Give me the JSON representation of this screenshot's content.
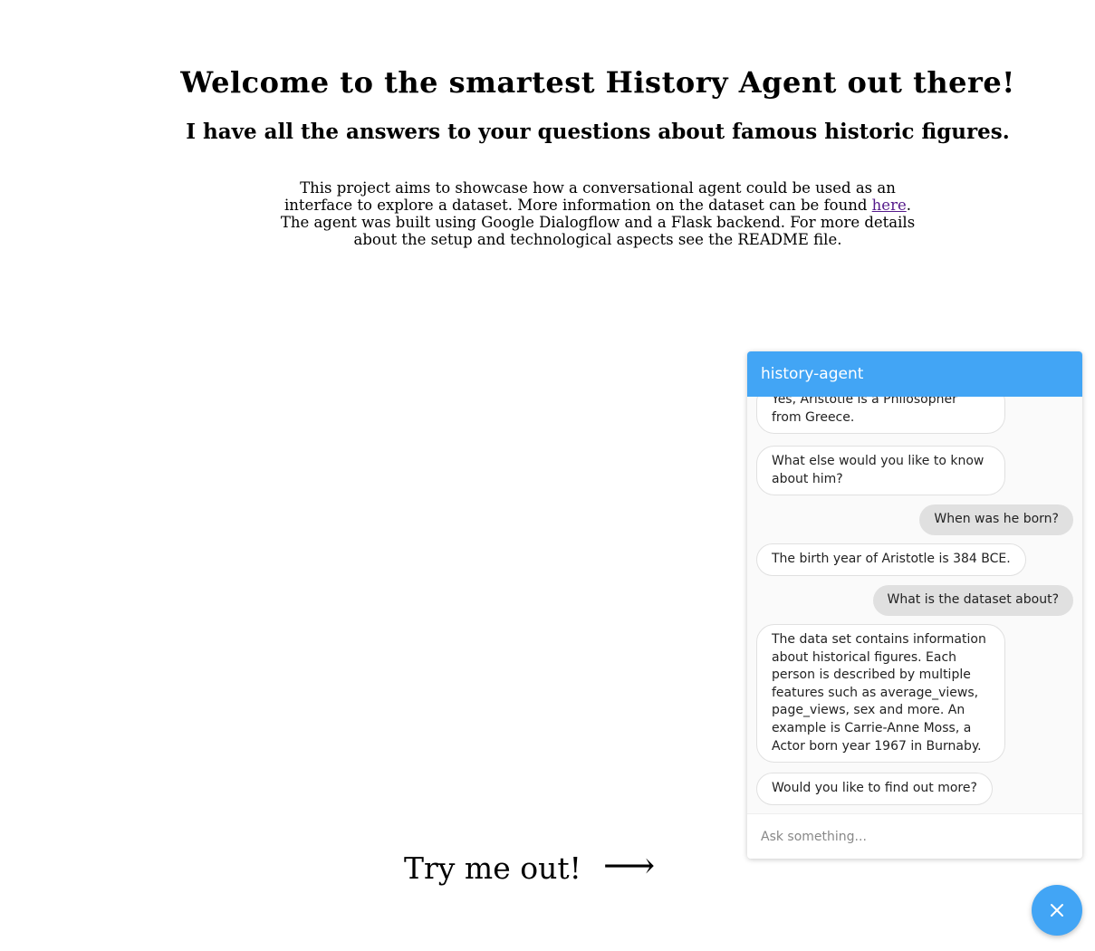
{
  "hero": {
    "title": "Welcome to the smartest History Agent out there!",
    "subtitle": "I have all the answers to your questions about famous historic figures.",
    "intro_before_link": "This project aims to showcase how a conversational agent could be used as an interface to explore a dataset. More information on the dataset can be found ",
    "intro_link": "here",
    "intro_after_link": ". The agent was built using Google Dialogflow and a Flask backend. For more details about the setup and technological aspects see the README file."
  },
  "try_me": {
    "label": "Try me out!",
    "arrow": "⟶"
  },
  "chat": {
    "title": "history-agent",
    "messages": [
      {
        "from": "bot",
        "text": "Yes, Aristotle is a Philosopher from Greece."
      },
      {
        "from": "bot",
        "text": "What else would you like to know about him?"
      },
      {
        "from": "user",
        "text": "When was he born?"
      },
      {
        "from": "bot",
        "text": "The birth year of Aristotle is 384 BCE."
      },
      {
        "from": "user",
        "text": "What is the dataset about?"
      },
      {
        "from": "bot",
        "text": "The data set contains information about historical figures. Each person is described by multiple features such as average_views, page_views, sex and more. An example is Carrie-Anne Moss, a Actor born year 1967 in Burnaby."
      },
      {
        "from": "bot",
        "text": "Would you like to find out more?"
      }
    ],
    "input_placeholder": "Ask something..."
  },
  "colors": {
    "accent": "#42a5f5",
    "link": "#551a8b"
  },
  "icons": {
    "fab": "close-icon",
    "arrow": "right-arrow-icon"
  }
}
